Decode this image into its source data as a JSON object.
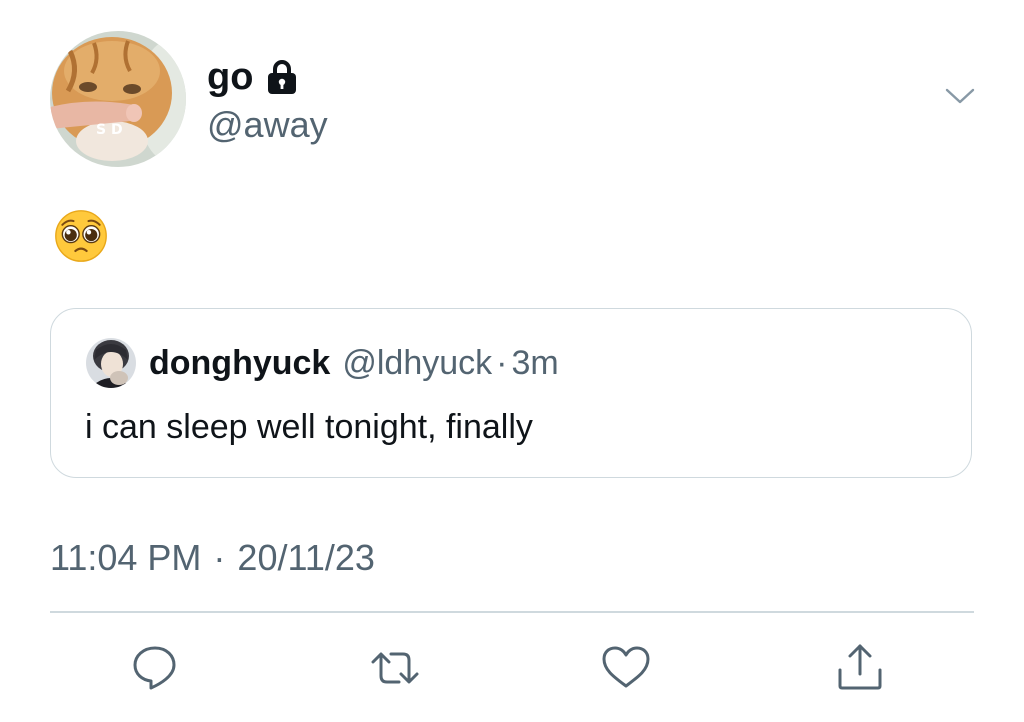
{
  "tweet": {
    "author": {
      "display_name": "go",
      "handle": "@away",
      "avatar_overlay_text": "S D",
      "protected": true
    },
    "text": "🥺",
    "quoted": {
      "display_name": "donghyuck",
      "handle": "@ldhyuck",
      "separator": "·",
      "time": "3m",
      "text": "i can sleep well tonight, finally"
    },
    "time": "11:04 PM",
    "separator": "·",
    "date": "20/11/23"
  },
  "icons": {
    "more": "chevron-down-icon",
    "lock": "lock-icon",
    "actions": [
      "reply-icon",
      "retweet-icon",
      "like-icon",
      "share-icon"
    ]
  },
  "colors": {
    "primary_text": "#0f1419",
    "secondary_text": "#536471",
    "border": "#cfd9de",
    "background": "#ffffff"
  }
}
